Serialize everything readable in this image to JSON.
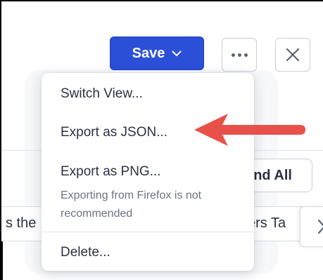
{
  "toolbar": {
    "save_label": "Save",
    "more_icon": "more-horizontal-icon",
    "close_icon": "close-icon"
  },
  "menu": {
    "items": [
      {
        "label": "Switch View..."
      },
      {
        "label": "Export as JSON..."
      },
      {
        "label": "Export as PNG...",
        "note": "Exporting from Firefox is not recommended"
      },
      {
        "label": "Delete..."
      }
    ]
  },
  "background": {
    "expand_button_label_partial": "nd All",
    "tab_left_partial": "s the",
    "tab_right_partial": "kers Ta"
  },
  "annotation": {
    "arrow_color": "#e8504a"
  },
  "colors": {
    "primary": "#2c4fd8",
    "text": "#2d3142",
    "muted": "#6b7383",
    "border": "#c9ced8"
  }
}
